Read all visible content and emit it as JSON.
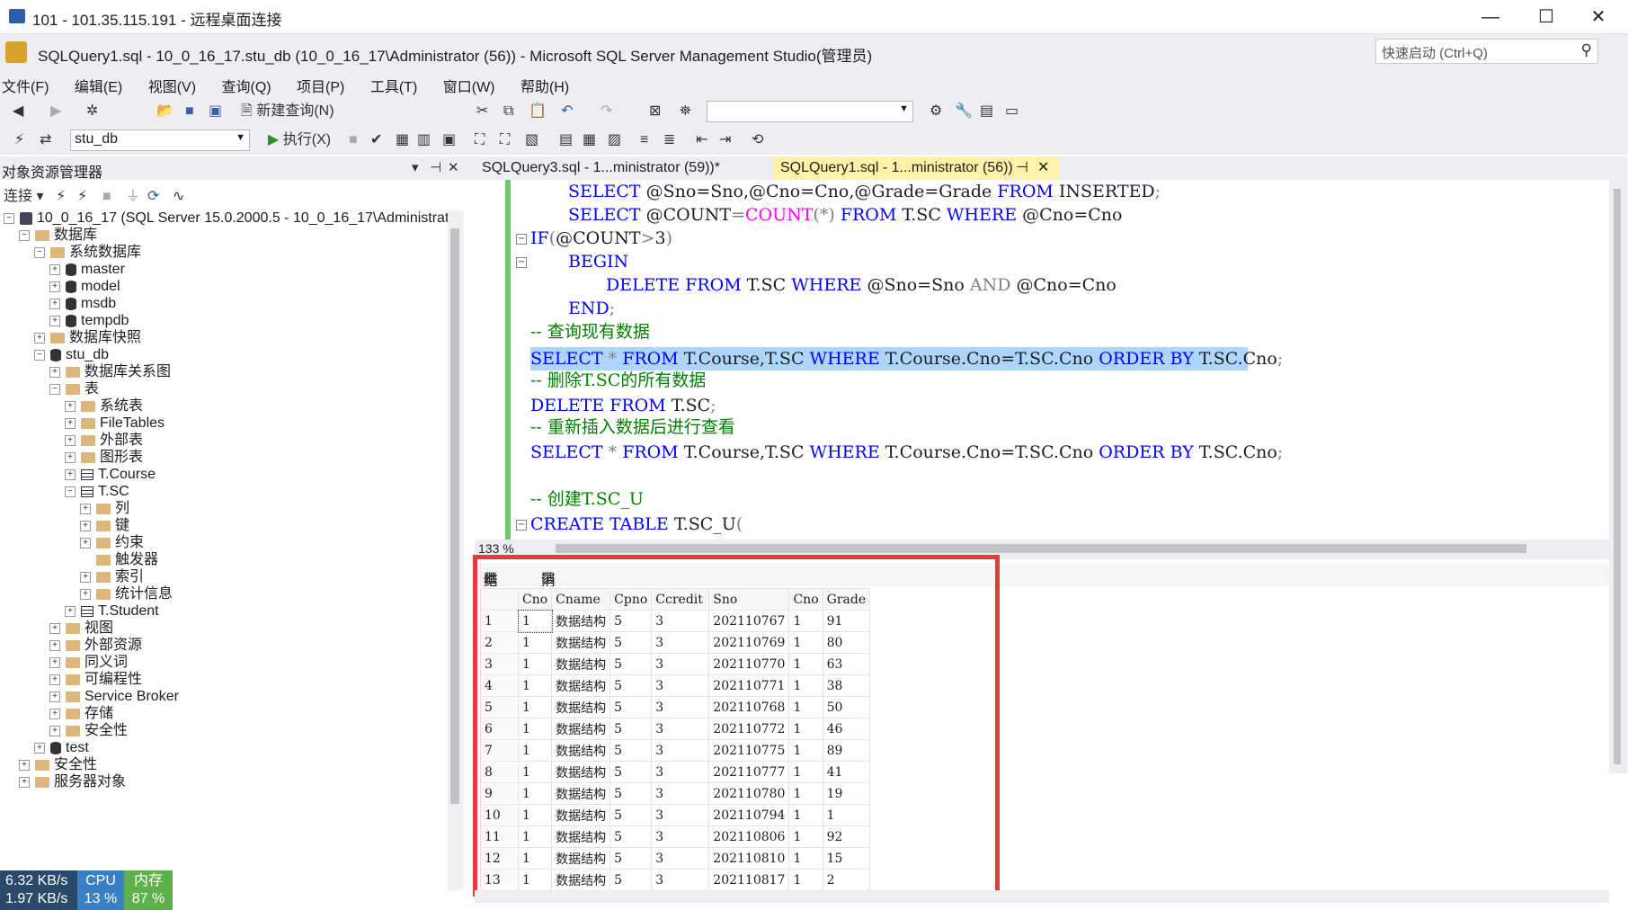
{
  "rdp": {
    "title": "101 - 101.35.115.191 - 远程桌面连接",
    "min": "—",
    "max": "☐",
    "close": "✕"
  },
  "app": {
    "title": "SQLQuery1.sql - 10_0_16_17.stu_db (10_0_16_17\\Administrator (56)) - Microsoft SQL Server Management Studio(管理员)",
    "quicklaunch": "快速启动 (Ctrl+Q)"
  },
  "menu": [
    "文件(F)",
    "编辑(E)",
    "视图(V)",
    "查询(Q)",
    "项目(P)",
    "工具(T)",
    "窗口(W)",
    "帮助(H)"
  ],
  "toolbar": {
    "new_query": "新建查询(N)",
    "database": "stu_db",
    "execute": "执行(X)"
  },
  "object_explorer": {
    "title": "对象资源管理器",
    "connect": "连接",
    "nodes": [
      {
        "label": "10_0_16_17 (SQL Server 15.0.2000.5 - 10_0_16_17\\Administrato",
        "icon": "server"
      },
      {
        "label": "数据库",
        "icon": "folder"
      },
      {
        "label": "系统数据库",
        "icon": "folder"
      },
      {
        "label": "master",
        "icon": "db"
      },
      {
        "label": "model",
        "icon": "db"
      },
      {
        "label": "msdb",
        "icon": "db"
      },
      {
        "label": "tempdb",
        "icon": "db"
      },
      {
        "label": "数据库快照",
        "icon": "folder"
      },
      {
        "label": "stu_db",
        "icon": "db"
      },
      {
        "label": "数据库关系图",
        "icon": "folder"
      },
      {
        "label": "表",
        "icon": "folder"
      },
      {
        "label": "系统表",
        "icon": "folder"
      },
      {
        "label": "FileTables",
        "icon": "folder"
      },
      {
        "label": "外部表",
        "icon": "folder"
      },
      {
        "label": "图形表",
        "icon": "folder"
      },
      {
        "label": "T.Course",
        "icon": "table"
      },
      {
        "label": "T.SC",
        "icon": "table"
      },
      {
        "label": "列",
        "icon": "folder"
      },
      {
        "label": "键",
        "icon": "folder"
      },
      {
        "label": "约束",
        "icon": "folder"
      },
      {
        "label": "触发器",
        "icon": "folder"
      },
      {
        "label": "索引",
        "icon": "folder"
      },
      {
        "label": "统计信息",
        "icon": "folder"
      },
      {
        "label": "T.Student",
        "icon": "table"
      },
      {
        "label": "视图",
        "icon": "folder"
      },
      {
        "label": "外部资源",
        "icon": "folder"
      },
      {
        "label": "同义词",
        "icon": "folder"
      },
      {
        "label": "可编程性",
        "icon": "folder"
      },
      {
        "label": "Service Broker",
        "icon": "folder"
      },
      {
        "label": "存储",
        "icon": "folder"
      },
      {
        "label": "安全性",
        "icon": "folder"
      },
      {
        "label": "test",
        "icon": "db"
      },
      {
        "label": "安全性",
        "icon": "folder"
      },
      {
        "label": "服务器对象",
        "icon": "folder"
      }
    ]
  },
  "tabs": [
    {
      "label": "SQLQuery3.sql - 1...ministrator (59))*"
    },
    {
      "label": "SQLQuery1.sql - 1...ministrator (56))",
      "pin": "⊣",
      "close": "✕"
    }
  ],
  "zoom": "133 %",
  "result_tabs": {
    "results": "结果",
    "messages": "消息"
  },
  "results": {
    "columns": [
      "Cno",
      "Cname",
      "Cpno",
      "Ccredit",
      "Sno",
      "Cno",
      "Grade"
    ],
    "rows": [
      [
        "1",
        "1",
        "数据结构",
        "5",
        "3",
        "202110767",
        "1",
        "91"
      ],
      [
        "2",
        "1",
        "数据结构",
        "5",
        "3",
        "202110769",
        "1",
        "80"
      ],
      [
        "3",
        "1",
        "数据结构",
        "5",
        "3",
        "202110770",
        "1",
        "63"
      ],
      [
        "4",
        "1",
        "数据结构",
        "5",
        "3",
        "202110771",
        "1",
        "38"
      ],
      [
        "5",
        "1",
        "数据结构",
        "5",
        "3",
        "202110768",
        "1",
        "50"
      ],
      [
        "6",
        "1",
        "数据结构",
        "5",
        "3",
        "202110772",
        "1",
        "46"
      ],
      [
        "7",
        "1",
        "数据结构",
        "5",
        "3",
        "202110775",
        "1",
        "89"
      ],
      [
        "8",
        "1",
        "数据结构",
        "5",
        "3",
        "202110777",
        "1",
        "41"
      ],
      [
        "9",
        "1",
        "数据结构",
        "5",
        "3",
        "202110780",
        "1",
        "19"
      ],
      [
        "10",
        "1",
        "数据结构",
        "5",
        "3",
        "202110794",
        "1",
        "1"
      ],
      [
        "11",
        "1",
        "数据结构",
        "5",
        "3",
        "202110806",
        "1",
        "92"
      ],
      [
        "12",
        "1",
        "数据结构",
        "5",
        "3",
        "202110810",
        "1",
        "15"
      ],
      [
        "13",
        "1",
        "数据结构",
        "5",
        "3",
        "202110817",
        "1",
        "2"
      ]
    ]
  },
  "netmon": {
    "speed": "6.32 KB/s",
    "speed2": "1.97 KB/s",
    "cpu_label": "CPU",
    "cpu": "13 %",
    "mem_label": "内存",
    "mem": "87 %"
  },
  "colors": {
    "selection": "#add6ff",
    "keyword": "#0000ff",
    "comment": "#008000",
    "highlight_box": "#e83a3a"
  }
}
